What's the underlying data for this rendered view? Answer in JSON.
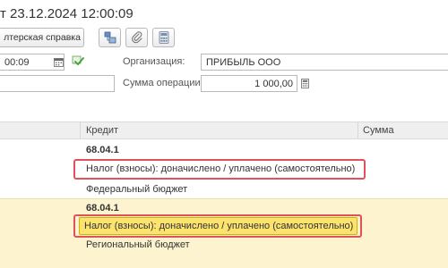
{
  "window": {
    "title": "т 23.12.2024 12:00:09"
  },
  "toolbar": {
    "report_button_label": "лтерская справка",
    "icons": [
      "structure-icon",
      "paperclip-icon",
      "calculator-icon"
    ]
  },
  "form": {
    "date_value": "00:09",
    "organization_label": "Организация:",
    "organization_value": "ПРИБЫЛЬ ООО",
    "amount_label": "Сумма операции:",
    "amount_value": "1 000,00"
  },
  "table": {
    "headers": [
      "Кредит",
      "Сумма"
    ],
    "rows": [
      {
        "account": "68.04.1",
        "subconto1": "Налог (взносы): доначислено / уплачено (самостоятельно)",
        "subconto2": "Федеральный бюджет",
        "selected": false
      },
      {
        "account": "68.04.1",
        "subconto1": "Налог (взносы): доначислено / уплачено (самостоятельно)",
        "subconto2": "Региональный бюджет",
        "selected": true
      }
    ]
  },
  "colors": {
    "highlight_border": "#e0525a",
    "selected_row": "#fdf4cf",
    "selected_cell": "#fbe36e"
  }
}
